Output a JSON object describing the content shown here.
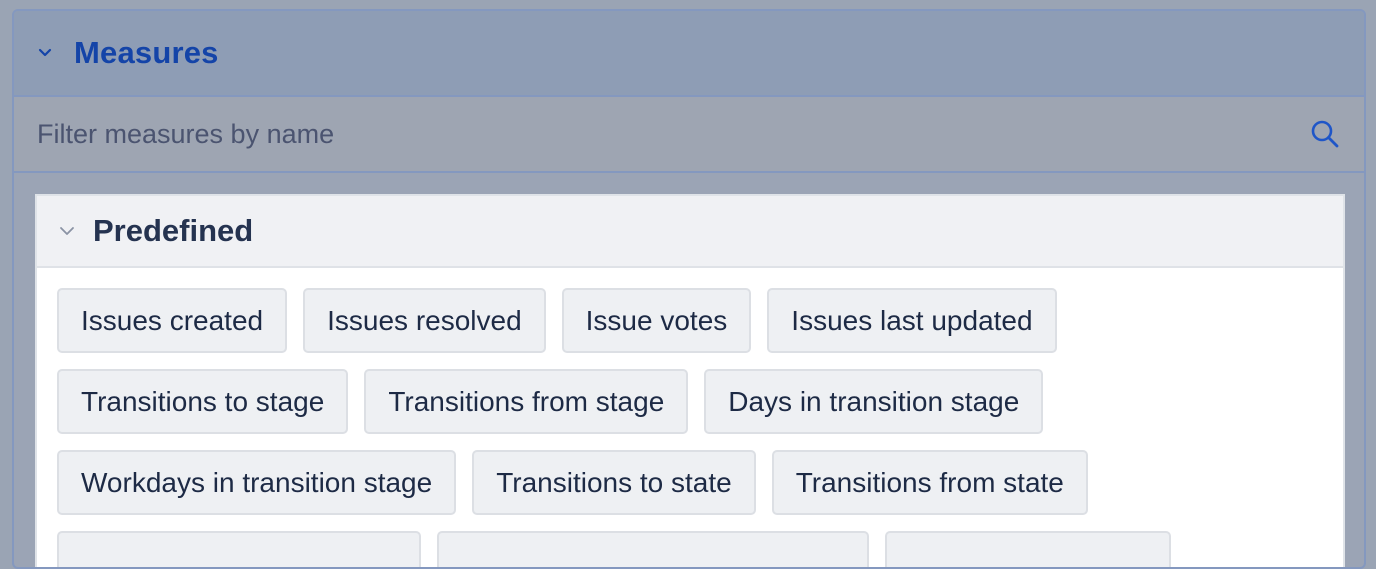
{
  "measures_panel": {
    "title": "Measures",
    "filter_placeholder": "Filter measures by name",
    "colors": {
      "title": "#1444a8",
      "accent_icon": "#1f56c8"
    },
    "icons": {
      "collapse": "chevron-down-icon",
      "search": "search-icon"
    }
  },
  "predefined_group": {
    "title": "Predefined",
    "chips": [
      "Issues created",
      "Issues resolved",
      "Issue votes",
      "Issues last updated",
      "Transitions to stage",
      "Transitions from stage",
      "Days in transition stage",
      "Workdays in transition stage",
      "Transitions to state",
      "Transitions from state",
      "",
      "",
      ""
    ]
  }
}
